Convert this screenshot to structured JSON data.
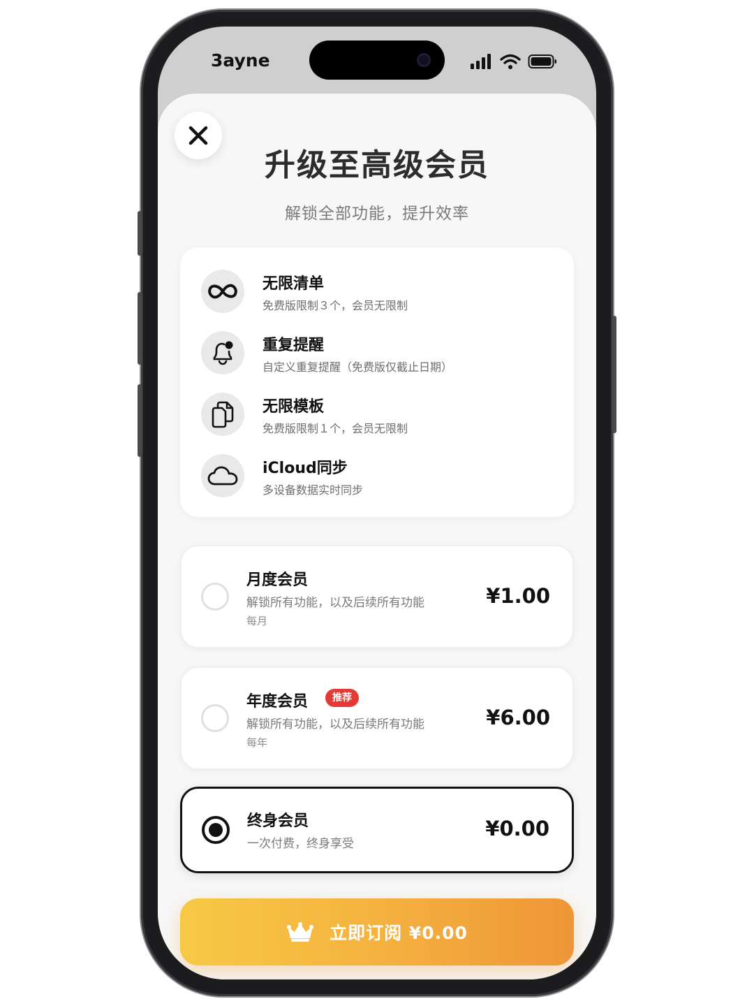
{
  "status_bar": {
    "carrier": "3ayne"
  },
  "header": {
    "title": "升级至高级会员",
    "subtitle": "解锁全部功能，提升效率"
  },
  "features": [
    {
      "icon": "infinity-icon",
      "title": "无限清单",
      "desc": "免费版限制３个，会员无限制"
    },
    {
      "icon": "bell-badge-icon",
      "title": "重复提醒",
      "desc": "自定义重复提醒（免费版仅截止日期）"
    },
    {
      "icon": "documents-icon",
      "title": "无限模板",
      "desc": "免费版限制１个，会员无限制"
    },
    {
      "icon": "cloud-icon",
      "title": "iCloud同步",
      "desc": "多设备数据实时同步"
    }
  ],
  "plans": [
    {
      "name": "月度会员",
      "desc": "解锁所有功能，以及后续所有功能",
      "period": "每月",
      "price": "¥1.00",
      "selected": false
    },
    {
      "name": "年度会员",
      "badge": "推荐",
      "desc": "解锁所有功能，以及后续所有功能",
      "period": "每年",
      "price": "¥6.00",
      "selected": false
    },
    {
      "name": "终身会员",
      "desc": "一次付费，终身享受",
      "price": "¥0.00",
      "selected": true
    }
  ],
  "subscribe_button": {
    "label": "立即订阅 ¥0.00",
    "icon": "crown-icon"
  },
  "colors": {
    "button_gradient_start": "#f6c945",
    "button_gradient_end": "#ee9638",
    "badge": "#e53935",
    "selected_border": "#111111"
  }
}
